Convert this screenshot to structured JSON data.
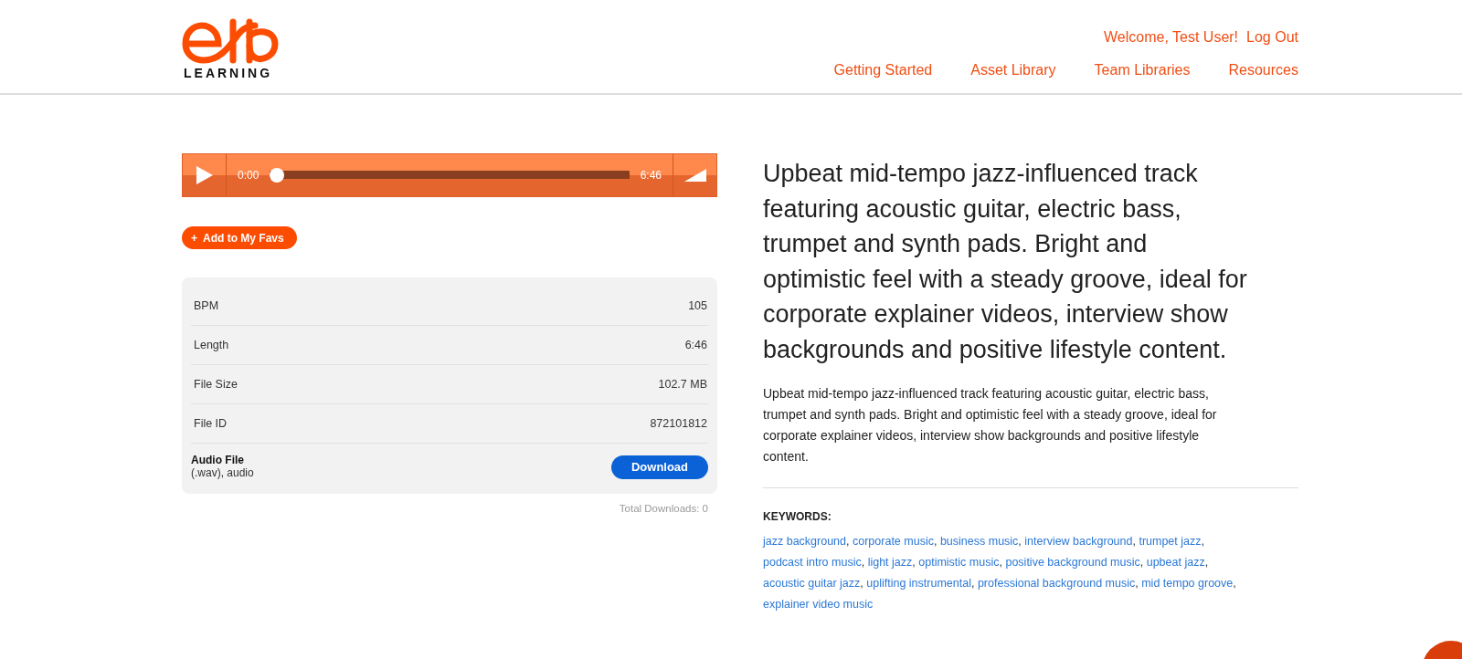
{
  "header": {
    "logo_word": "LEARNING",
    "welcome": "Welcome, Test User!",
    "logout": "Log Out",
    "nav": [
      {
        "label": "Getting Started"
      },
      {
        "label": "Asset Library"
      },
      {
        "label": "Team Libraries"
      },
      {
        "label": "Resources"
      }
    ]
  },
  "player": {
    "current": "0:00",
    "duration": "6:46",
    "level": 0
  },
  "favs_button": {
    "icon": "+",
    "label": "Add to My Favs"
  },
  "details": [
    {
      "label": "BPM",
      "value": "105"
    },
    {
      "label": "Length",
      "value": "6:46"
    },
    {
      "label": "File Size",
      "value": "102.7 MB"
    },
    {
      "label": "File ID",
      "value": "872101812"
    }
  ],
  "file": {
    "title": "Audio File",
    "subtitle": "(.wav), audio",
    "button": "Download"
  },
  "total_downloads": "Total Downloads: 0",
  "headline": "Upbeat mid-tempo jazz-influenced track featuring acoustic guitar, electric bass, trumpet and synth pads. Bright and optimistic feel with a steady groove, ideal for corporate explainer videos, interview show backgrounds and positive lifestyle content.",
  "description": "Upbeat mid-tempo jazz-influenced track featuring acoustic guitar, electric bass, trumpet and synth pads. Bright and optimistic feel with a steady groove, ideal for corporate explainer videos, interview show backgrounds and positive lifestyle content.",
  "keywords": {
    "title": "KEYWORDS:",
    "separator": ",",
    "items": [
      "jazz background",
      "corporate music",
      "business music",
      "interview background",
      "trumpet jazz",
      "podcast intro music",
      "light jazz",
      "optimistic music",
      "positive background music",
      "upbeat jazz",
      "acoustic guitar jazz",
      "uplifting instrumental",
      "professional background music",
      "mid tempo groove",
      "explainer video music"
    ]
  }
}
